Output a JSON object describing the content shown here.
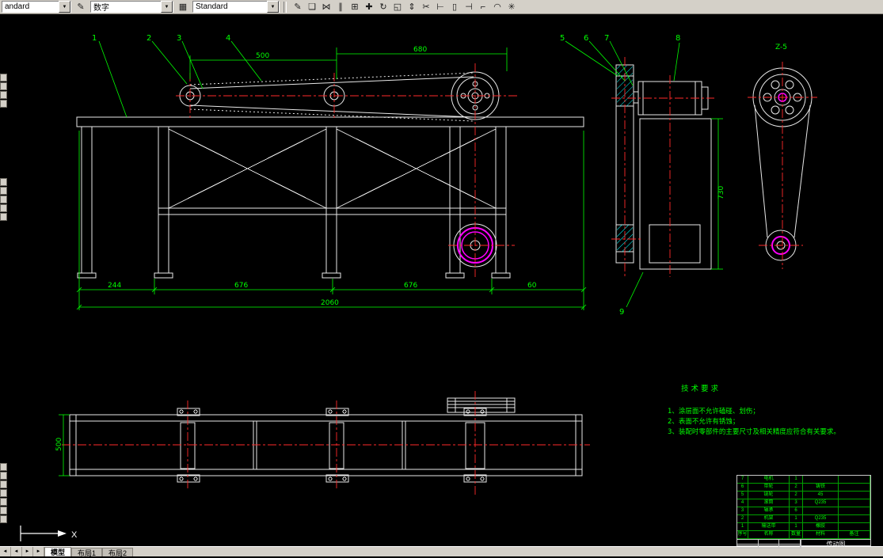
{
  "toolbar": {
    "combo_style": "andard",
    "combo_dim": "数字",
    "combo_text": "Standard",
    "icons": [
      {
        "name": "erase",
        "glyph": "✎"
      },
      {
        "name": "copy",
        "glyph": "❏"
      },
      {
        "name": "mirror",
        "glyph": "⋈"
      },
      {
        "name": "offset",
        "glyph": "∥"
      },
      {
        "name": "array",
        "glyph": "⊞"
      },
      {
        "name": "move",
        "glyph": "✚"
      },
      {
        "name": "rotate",
        "glyph": "↻"
      },
      {
        "name": "scale",
        "glyph": "◱"
      },
      {
        "name": "stretch",
        "glyph": "⇕"
      },
      {
        "name": "trim",
        "glyph": "✂"
      },
      {
        "name": "extend",
        "glyph": "⊢"
      },
      {
        "name": "break-at-point",
        "glyph": "▯"
      },
      {
        "name": "break",
        "glyph": "⊣"
      },
      {
        "name": "chamfer",
        "glyph": "⌐"
      },
      {
        "name": "fillet",
        "glyph": "◠"
      },
      {
        "name": "explode",
        "glyph": "✳"
      }
    ]
  },
  "tabs": {
    "nav": [
      "◄",
      "◄",
      "►",
      "►"
    ],
    "items": [
      {
        "id": "model",
        "label": "模型",
        "active": true
      },
      {
        "id": "layout1",
        "label": "布局1",
        "active": false
      },
      {
        "id": "layout2",
        "label": "布局2",
        "active": false
      }
    ]
  },
  "drawing": {
    "balloons": [
      "1",
      "2",
      "3",
      "4",
      "5",
      "6",
      "7",
      "8",
      "9"
    ],
    "dims": {
      "top_left": "500",
      "top_right": "680",
      "bottom_1": "244",
      "bottom_2": "676",
      "bottom_3": "676",
      "bottom_4": "60",
      "overall": "2060",
      "side_height": "730",
      "belt_width": "500"
    },
    "labels": {
      "detail": "Z-5",
      "axis_x": "X"
    },
    "tech_requirements": {
      "title": "技 术 要 求",
      "items": [
        "1、涂层面不允许磕碰、划伤；",
        "2、表面不允许有锈蚀；",
        "3、装配时零部件的主要尺寸及相关精度应符合有关要求。"
      ]
    },
    "title_block": {
      "columns": [
        "序号",
        "名称",
        "数量",
        "材料",
        "备注"
      ],
      "rows": [
        [
          "7",
          "电机",
          "1",
          "",
          ""
        ],
        [
          "6",
          "带轮",
          "2",
          "铸铁",
          ""
        ],
        [
          "5",
          "链轮",
          "2",
          "45",
          ""
        ],
        [
          "4",
          "滚筒",
          "3",
          "Q235",
          ""
        ],
        [
          "3",
          "轴承",
          "6",
          "",
          ""
        ],
        [
          "2",
          "机架",
          "1",
          "Q235",
          ""
        ],
        [
          "1",
          "输送带",
          "1",
          "橡胶",
          ""
        ]
      ],
      "drawing_name": "传动图"
    }
  }
}
